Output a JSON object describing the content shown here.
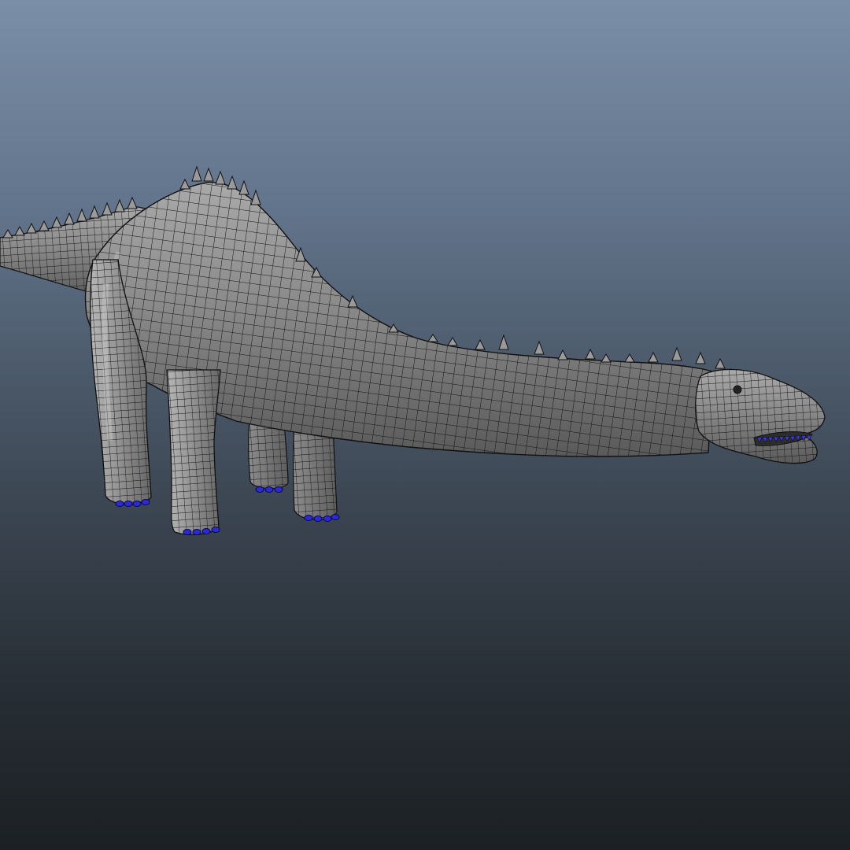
{
  "viewport": {
    "background_top": "#7a8ea7",
    "background_bottom": "#1c2024"
  },
  "model": {
    "subject": "sauropod-dinosaur-wireframe",
    "surface_color": "#8c8c8c",
    "wire_color": "#111111",
    "toe_color": "#2a2ad8"
  }
}
